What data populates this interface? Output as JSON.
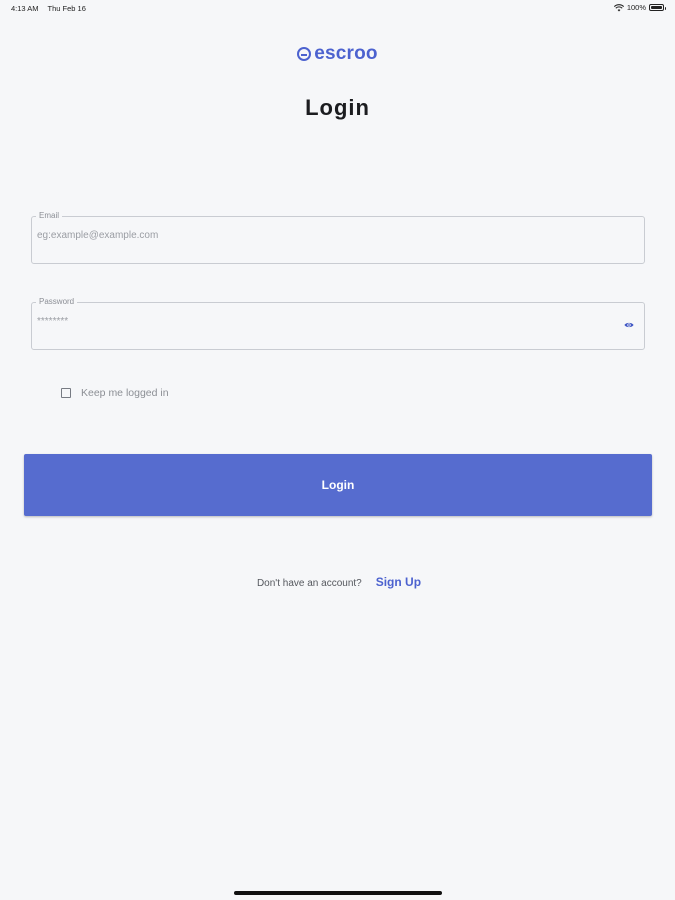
{
  "status_bar": {
    "time": "4:13 AM",
    "date": "Thu Feb 16",
    "battery_percent": "100%",
    "battery_level": 1.0
  },
  "brand": {
    "name": "escroo",
    "color": "#4c62cf"
  },
  "title": "Login",
  "email": {
    "label": "Email",
    "placeholder": "eg:example@example.com",
    "value": ""
  },
  "password": {
    "label": "Password",
    "placeholder": "********",
    "value": "",
    "toggle_icon": "eye-icon"
  },
  "keep_logged_in": {
    "label": "Keep me logged in",
    "checked": false
  },
  "login_button": {
    "label": "Login",
    "color": "#566ccf"
  },
  "signup": {
    "prompt": "Don't have an account?",
    "link": "Sign Up"
  }
}
